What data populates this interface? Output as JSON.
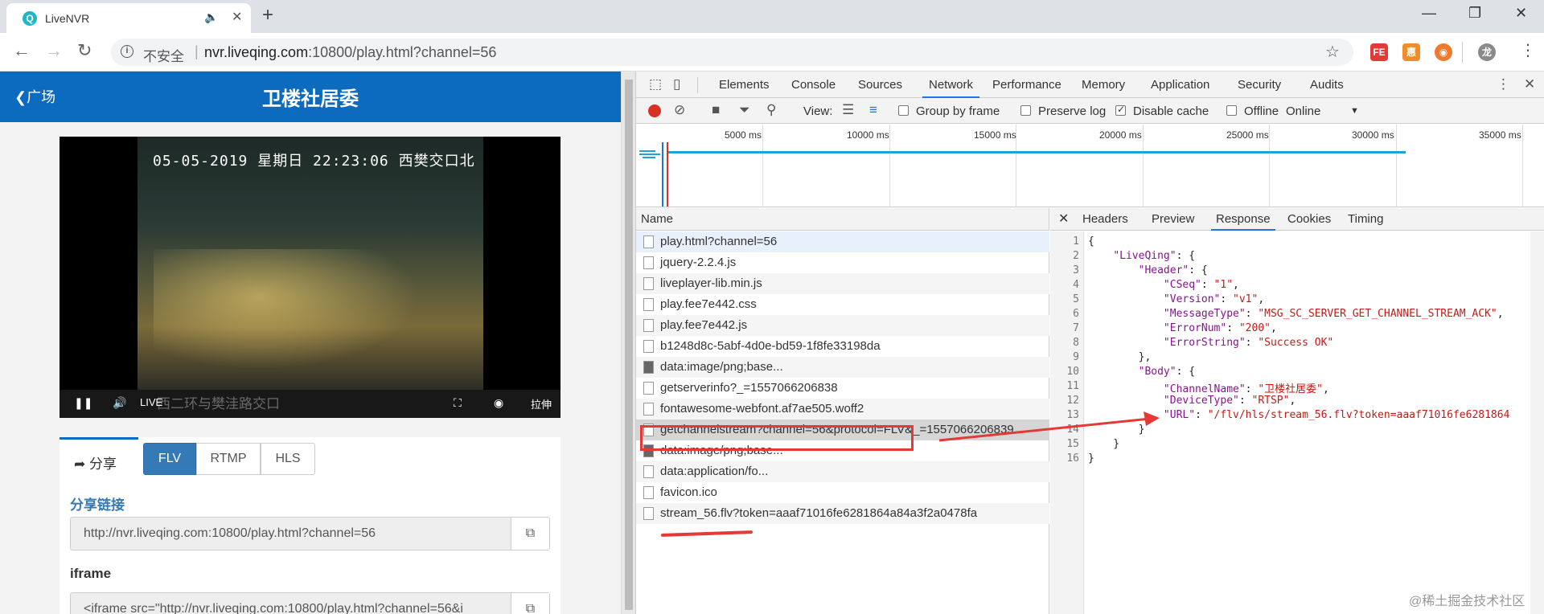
{
  "browser": {
    "tab_title": "LiveNVR",
    "tab_icon": "Q",
    "insecure_label": "不安全",
    "url_host": "nvr.liveqing.com",
    "url_rest": ":10800/play.html?channel=56",
    "extensions": [
      {
        "name": "FE",
        "color": "#e53935"
      },
      {
        "name": "惠",
        "color": "#f08c2b"
      },
      {
        "name": "◉",
        "color": "#f07a2b"
      },
      {
        "name": "龙",
        "color": "#8a8a8a"
      }
    ]
  },
  "page": {
    "back_label": "广场",
    "title": "卫楼社居委",
    "video": {
      "timestamp": "05-05-2019  星期日 22:23:06  西樊交口北",
      "overlay_text": "西二环与樊洼路交口",
      "live_label": "LIVE",
      "stretch_label": "拉伸"
    },
    "share": {
      "tab_label": "分享",
      "protocols": [
        "FLV",
        "RTMP",
        "HLS"
      ],
      "active_protocol": "FLV",
      "share_link_label": "分享链接",
      "share_link_value": "http://nvr.liveqing.com:10800/play.html?channel=56",
      "iframe_label": "iframe",
      "iframe_value": "<iframe src=\"http://nvr.liveqing.com:10800/play.html?channel=56&i"
    }
  },
  "devtools": {
    "tabs": [
      "Elements",
      "Console",
      "Sources",
      "Network",
      "Performance",
      "Memory",
      "Application",
      "Security",
      "Audits"
    ],
    "active_tab": "Network",
    "filter": {
      "view_label": "View:",
      "group_by_frame": "Group by frame",
      "preserve_log": "Preserve log",
      "disable_cache": "Disable cache",
      "offline": "Offline",
      "throttle": "Online"
    },
    "timeline_ticks": [
      "5000 ms",
      "10000 ms",
      "15000 ms",
      "20000 ms",
      "25000 ms",
      "30000 ms",
      "35000 ms"
    ],
    "name_header": "Name",
    "requests": [
      "play.html?channel=56",
      "jquery-2.2.4.js",
      "liveplayer-lib.min.js",
      "play.fee7e442.css",
      "play.fee7e442.js",
      "b1248d8c-5abf-4d0e-bd59-1f8fe33198da",
      "data:image/png;base...",
      "getserverinfo?_=1557066206838",
      "fontawesome-webfont.af7ae505.woff2",
      "getchannelstream?channel=56&protocol=FLV&_=1557066206839",
      "data:image/png;base...",
      "data:application/fo...",
      "favicon.ico",
      "stream_56.flv?token=aaaf71016fe6281864a84a3f2a0478fa"
    ],
    "detail_tabs": [
      "Headers",
      "Preview",
      "Response",
      "Cookies",
      "Timing"
    ],
    "active_detail_tab": "Response",
    "response_lines": [
      "{",
      "    \"LiveQing\": {",
      "        \"Header\": {",
      "            \"CSeq\": \"1\",",
      "            \"Version\": \"v1\",",
      "            \"MessageType\": \"MSG_SC_SERVER_GET_CHANNEL_STREAM_ACK\",",
      "            \"ErrorNum\": \"200\",",
      "            \"ErrorString\": \"Success OK\"",
      "        },",
      "        \"Body\": {",
      "            \"ChannelName\": \"卫楼社居委\",",
      "            \"DeviceType\": \"RTSP\",",
      "            \"URL\": \"/flv/hls/stream_56.flv?token=aaaf71016fe6281864",
      "        }",
      "    }",
      "}"
    ]
  },
  "watermark": "@稀土掘金技术社区"
}
